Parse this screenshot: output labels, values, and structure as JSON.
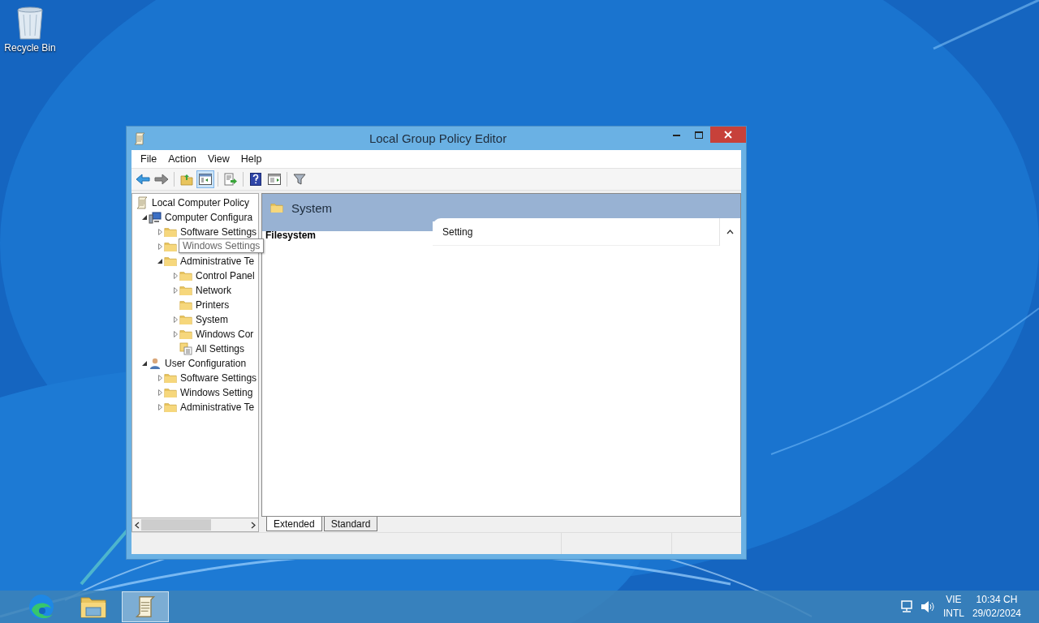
{
  "desktop_icons": [
    {
      "label": "Recycle Bin",
      "kind": "recycle-bin"
    }
  ],
  "window": {
    "title": "Local Group Policy Editor",
    "menu": [
      "File",
      "Action",
      "View",
      "Help"
    ],
    "toolbar": [
      {
        "kind": "back",
        "pressed": false
      },
      {
        "kind": "forward",
        "pressed": false
      },
      {
        "kind": "sep"
      },
      {
        "kind": "up",
        "pressed": false
      },
      {
        "kind": "tree",
        "pressed": true
      },
      {
        "kind": "sep"
      },
      {
        "kind": "export",
        "pressed": false
      },
      {
        "kind": "sep"
      },
      {
        "kind": "help",
        "pressed": false
      },
      {
        "kind": "pane",
        "pressed": false
      },
      {
        "kind": "sep"
      },
      {
        "kind": "filter",
        "pressed": false
      }
    ],
    "tree": [
      {
        "label": "Local Computer Policy",
        "kind": "policy",
        "children": [
          {
            "label": "Computer Configura",
            "kind": "computer",
            "expanded": true,
            "children": [
              {
                "label": "Software Settings",
                "kind": "folder",
                "expanded": false
              },
              {
                "label": "Windows Settings",
                "kind": "folder",
                "expanded": false,
                "tooltip": true
              },
              {
                "label": "Administrative Te",
                "kind": "folder",
                "expanded": true,
                "children": [
                  {
                    "label": "Control Panel",
                    "kind": "folder",
                    "expanded": false
                  },
                  {
                    "label": "Network",
                    "kind": "folder",
                    "expanded": false
                  },
                  {
                    "label": "Printers",
                    "kind": "folder"
                  },
                  {
                    "label": "System",
                    "kind": "folder",
                    "expanded": false
                  },
                  {
                    "label": "Windows Cor",
                    "kind": "folder",
                    "expanded": false
                  },
                  {
                    "label": "All Settings",
                    "kind": "all-settings"
                  }
                ]
              }
            ]
          },
          {
            "label": "User Configuration",
            "kind": "user",
            "expanded": true,
            "children": [
              {
                "label": "Software Settings",
                "kind": "folder",
                "expanded": false
              },
              {
                "label": "Windows Setting",
                "kind": "folder",
                "expanded": false
              },
              {
                "label": "Administrative Te",
                "kind": "folder",
                "expanded": false
              }
            ]
          }
        ]
      }
    ],
    "details": {
      "heading": "System",
      "selected_item": "Filesystem",
      "column": "Setting"
    },
    "tabs": [
      {
        "label": "Extended",
        "selected": true
      },
      {
        "label": "Standard",
        "selected": false
      }
    ]
  },
  "taskbar": {
    "apps": [
      {
        "kind": "edge",
        "active": false
      },
      {
        "kind": "explorer",
        "active": false
      },
      {
        "kind": "policy",
        "active": true
      }
    ],
    "language": [
      "VIE",
      "INTL"
    ],
    "time": "10:34 CH",
    "date": "29/02/2024"
  }
}
